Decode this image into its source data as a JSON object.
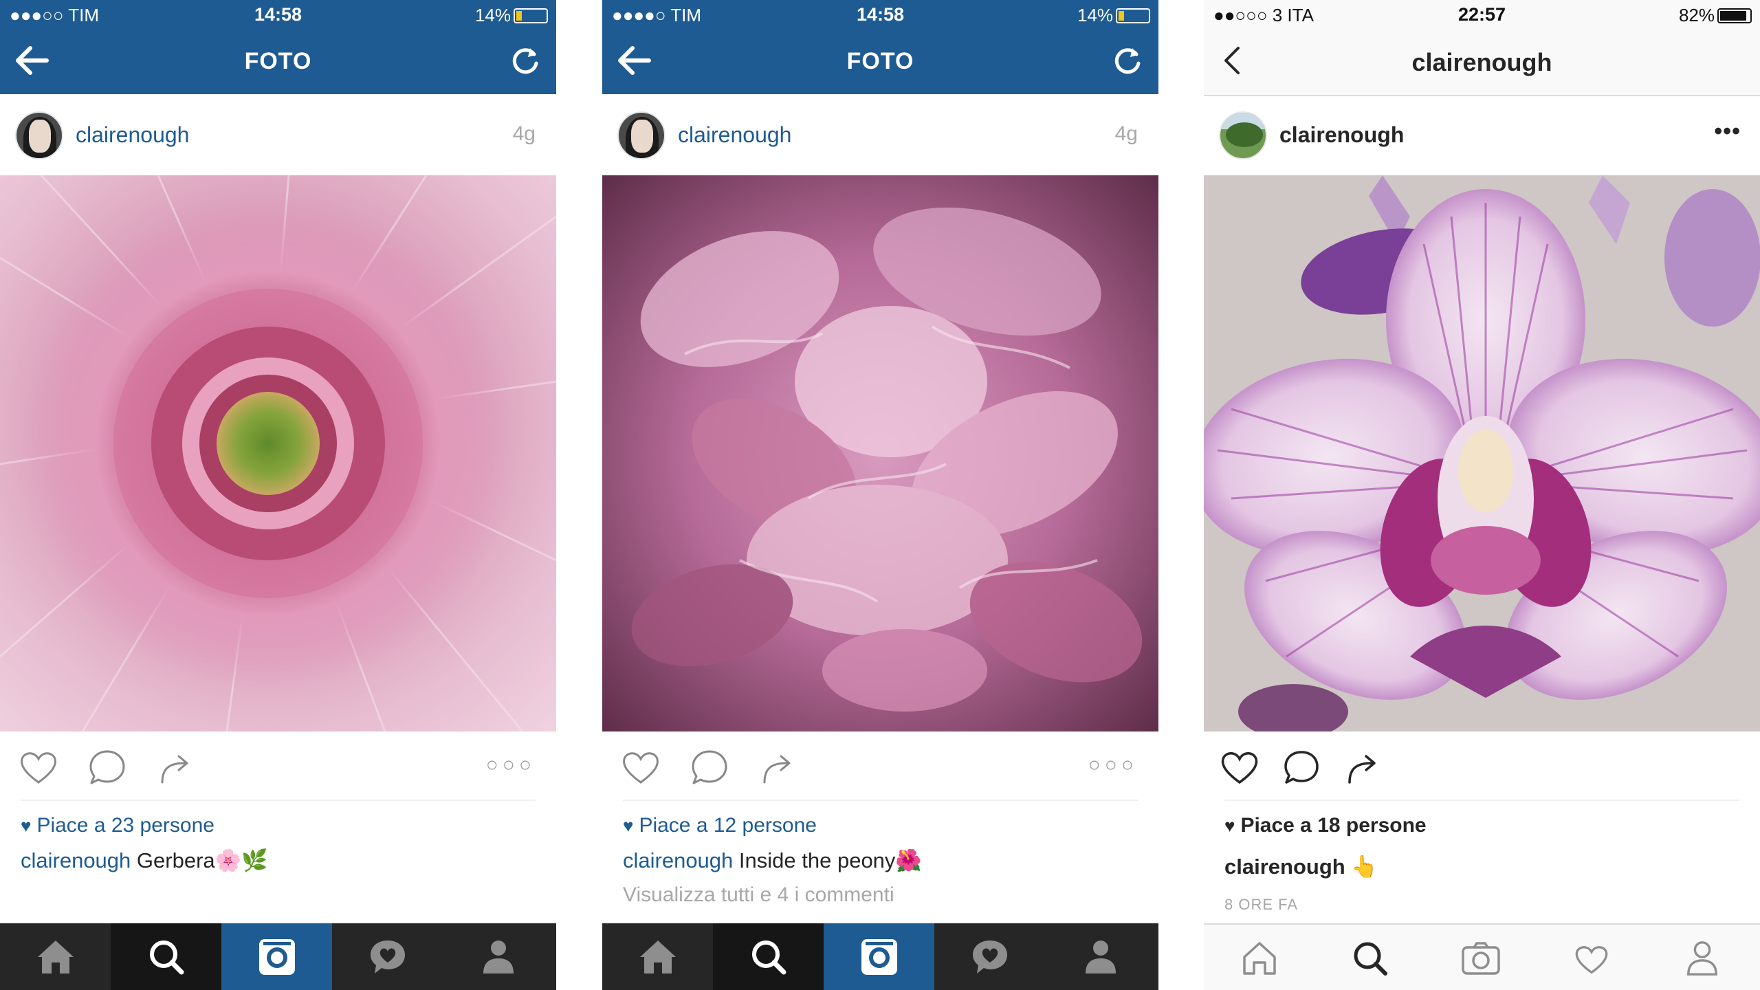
{
  "screens": [
    {
      "status": {
        "carrier": "●●●○○ TIM",
        "time": "14:58",
        "battery": "14%"
      },
      "nav": {
        "title": "FOTO"
      },
      "post": {
        "username": "clairenough",
        "time_ago": "4g",
        "likes": "Piace a 23 persone",
        "caption_user": "clairenough",
        "caption_text": "Gerbera🌸🌿"
      }
    },
    {
      "status": {
        "carrier": "●●●●○ TIM",
        "time": "14:58",
        "battery": "14%"
      },
      "nav": {
        "title": "FOTO"
      },
      "post": {
        "username": "clairenough",
        "time_ago": "4g",
        "likes": "Piace a 12 persone",
        "caption_user": "clairenough",
        "caption_text": "Inside the peony🌺",
        "comments_link": "Visualizza tutti e 4 i commenti"
      }
    },
    {
      "status": {
        "carrier": "●●○○○ 3 ITA",
        "time": "22:57",
        "battery": "82%"
      },
      "nav": {
        "title": "clairenough"
      },
      "post": {
        "username": "clairenough",
        "likes": "Piace a 18 persone",
        "caption_user": "clairenough",
        "caption_text": "👆",
        "timestamp": "8 ORE FA"
      }
    }
  ],
  "colors": {
    "brand_blue": "#1e5b92",
    "tabbar_dark": "#262626"
  },
  "icons": [
    "back-arrow-icon",
    "refresh-icon",
    "heart-icon",
    "comment-icon",
    "share-icon",
    "more-icon",
    "home-icon",
    "search-icon",
    "camera-icon",
    "activity-icon",
    "profile-icon"
  ]
}
